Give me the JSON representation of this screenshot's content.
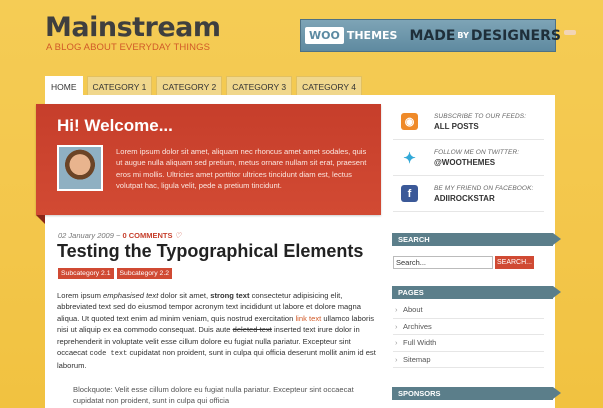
{
  "header": {
    "title": "Mainstream",
    "tagline": "A BLOG ABOUT EVERYDAY THINGS"
  },
  "banner": {
    "woo": "WOO",
    "themes": "THEMES",
    "made": "MADE",
    "by": "BY",
    "designers": "DESIGNERS"
  },
  "nav": {
    "items": [
      "HOME",
      "CATEGORY 1",
      "CATEGORY 2",
      "CATEGORY 3",
      "CATEGORY 4"
    ]
  },
  "welcome": {
    "title": "Hi! Welcome...",
    "text": "Lorem ipsum dolor sit amet, aliquam nec rhoncus amet amet sodales, quis ut augue nulla aliquam sed pretium, metus ornare nullam sit erat, praesent eros mi mollis. Ultricies amet porttitor ultrices tincidunt diam est, lectus volutpat hac, ligula velit, pede a pretium tincidunt."
  },
  "social": {
    "rows": [
      {
        "icon": "rss-icon",
        "small": "SUBSCRIBE TO OUR FEEDS:",
        "big": "ALL POSTS"
      },
      {
        "icon": "twitter-icon",
        "small": "FOLLOW ME ON TWITTER:",
        "big": "@WOOTHEMES"
      },
      {
        "icon": "facebook-icon",
        "small": "BE MY FRIEND ON FACEBOOK:",
        "big": "ADIIROCKSTAR"
      }
    ]
  },
  "post": {
    "date": "02 January 2009 ~",
    "comments": "0 COMMENTS",
    "title": "Testing the Typographical Elements",
    "categories": [
      "Subcategory 2.1",
      "Subcategory 2.2"
    ],
    "body": {
      "p1": "Lorem ipsum ",
      "em": "emphasised text",
      "p2": " dolor sit amet, ",
      "strong": "strong text",
      "p3": " consectetur adipisicing elit, abbreviated text sed do eiusmod tempor acronym text incididunt ut labore et dolore magna aliqua. Ut quoted text enim ad minim veniam, quis nostrud exercitation ",
      "link": "link text",
      "p4": " ullamco laboris nisi ut aliquip ex ea commodo consequat. Duis aute ",
      "del": "deleted text",
      "p5": " inserted text irure dolor in reprehenderit in voluptate velit esse cillum dolore eu fugiat nulla pariatur. Excepteur sint occaecat ",
      "code": "code text",
      "p6": " cupidatat non proident, sunt in culpa qui officia deserunt mollit anim id est laborum."
    },
    "blockquote": "Blockquote: Velit esse cillum dolore eu fugiat nulla pariatur. Excepteur sint occaecat cupidatat non proident, sunt in culpa qui officia"
  },
  "sidebar": {
    "search_title": "SEARCH",
    "search_value": "Search...",
    "search_button": "SEARCH...",
    "pages_title": "PAGES",
    "pages": [
      "About",
      "Archives",
      "Full Width",
      "Sitemap"
    ],
    "sponsors_title": "SPONSORS"
  }
}
